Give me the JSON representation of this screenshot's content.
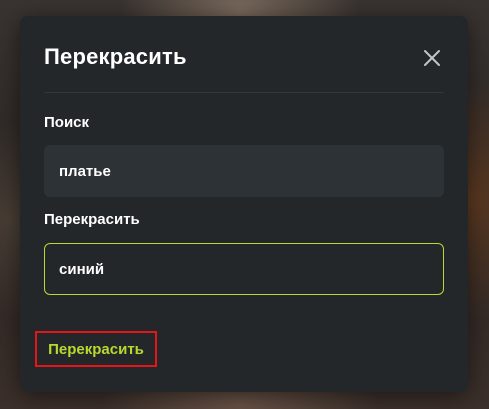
{
  "dialog": {
    "title": "Перекрасить",
    "close_icon": "close-icon"
  },
  "search": {
    "label": "Поиск",
    "value": "платье"
  },
  "recolor": {
    "label": "Перекрасить",
    "value": "синий"
  },
  "submit": {
    "label": "Перекрасить"
  },
  "colors": {
    "accent": "#b8d92e",
    "dialog_bg": "#23272a",
    "input_bg": "#2d3236",
    "highlight_border": "#e5161b"
  }
}
